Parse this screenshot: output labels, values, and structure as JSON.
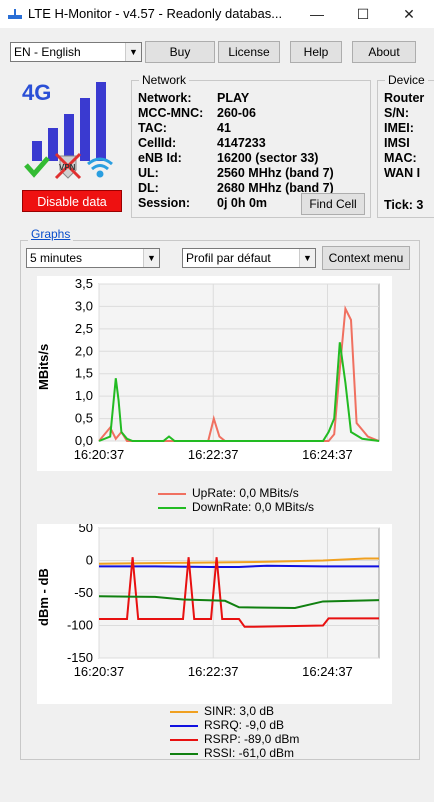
{
  "window": {
    "title": "LTE H-Monitor - v4.57 - Readonly databas...",
    "minimize": "—",
    "maximize": "☐",
    "close": "✕"
  },
  "toolbar": {
    "language": "EN - English",
    "buy": "Buy",
    "license": "License",
    "help": "Help",
    "about": "About"
  },
  "status": {
    "badge": "4G",
    "vpn": "VPN",
    "disable_data": "Disable data",
    "signal_bars": 5
  },
  "network": {
    "title": "Network",
    "rows": [
      {
        "label": "Network:",
        "value": "PLAY"
      },
      {
        "label": "MCC-MNC:",
        "value": "260-06"
      },
      {
        "label": "TAC:",
        "value": "41"
      },
      {
        "label": "CellId:",
        "value": "4147233"
      },
      {
        "label": "eNB Id:",
        "value": "16200 (sector 33)"
      },
      {
        "label": "UL:",
        "value": "2560 MHhz (band 7)"
      },
      {
        "label": "DL:",
        "value": "2680 MHhz (band 7)"
      },
      {
        "label": "Session:",
        "value": "0j 0h 0m"
      }
    ],
    "find_cell": "Find Cell"
  },
  "device": {
    "title": "Device",
    "rows": [
      "Router",
      "S/N:",
      "IMEI:",
      "IMSI",
      "MAC:",
      "WAN I"
    ],
    "tick": "Tick: 3"
  },
  "graphs": {
    "title": "Graphs",
    "interval": "5 minutes",
    "profile": "Profil par défaut",
    "context_menu": "Context menu"
  },
  "chart_data": [
    {
      "type": "line",
      "ylabel": "MBits/s",
      "ylim": [
        0,
        3.5
      ],
      "yticks": [
        "3,5",
        "3,0",
        "2,5",
        "2,0",
        "1,5",
        "1,0",
        "0,5",
        "0,0"
      ],
      "xticks": [
        "16:20:37",
        "16:22:37",
        "16:24:37"
      ],
      "series": [
        {
          "name": "UpRate: 0,0 MBits/s",
          "color": "#f07060",
          "x": [
            0,
            0.04,
            0.06,
            0.08,
            0.1,
            0.12,
            0.14,
            0.39,
            0.41,
            0.43,
            0.45,
            0.82,
            0.84,
            0.86,
            0.88,
            0.9,
            0.92,
            0.94,
            0.96,
            1.0
          ],
          "values": [
            0,
            0.3,
            0.05,
            0.2,
            0,
            0,
            0,
            0,
            0.5,
            0.1,
            0,
            0,
            0.15,
            1.6,
            2.95,
            2.7,
            0.4,
            0.25,
            0.1,
            0
          ]
        },
        {
          "name": "DownRate: 0,0 MBits/s",
          "color": "#22bb22",
          "x": [
            0,
            0.04,
            0.06,
            0.07,
            0.08,
            0.1,
            0.12,
            0.23,
            0.25,
            0.27,
            0.6,
            0.8,
            0.82,
            0.84,
            0.86,
            0.88,
            0.9,
            0.94,
            1.0
          ],
          "values": [
            0,
            0.1,
            1.4,
            0.9,
            0.2,
            0.05,
            0,
            0,
            0.1,
            0,
            0,
            0,
            0.2,
            0.5,
            2.2,
            1.3,
            0.2,
            0.05,
            0
          ]
        }
      ]
    },
    {
      "type": "line",
      "ylabel": "dBm - dB",
      "ylim": [
        -150,
        50
      ],
      "yticks": [
        "50",
        "0",
        "-50",
        "-100",
        "-150"
      ],
      "xticks": [
        "16:20:37",
        "16:22:37",
        "16:24:37"
      ],
      "series": [
        {
          "name": "SINR: 3,0 dB",
          "color": "#f0a020",
          "x": [
            0,
            0.2,
            0.4,
            0.6,
            0.8,
            0.95,
            1.0
          ],
          "values": [
            -5,
            -4,
            -3,
            -2,
            0,
            3,
            3
          ]
        },
        {
          "name": "RSRQ: -9,0 dB",
          "color": "#1010e0",
          "x": [
            0,
            0.2,
            0.4,
            0.5,
            0.6,
            0.8,
            1.0
          ],
          "values": [
            -9,
            -9,
            -10,
            -10,
            -8,
            -9,
            -9
          ]
        },
        {
          "name": "RSRP: -89,0 dBm",
          "color": "#e81010",
          "x": [
            0,
            0.1,
            0.12,
            0.14,
            0.3,
            0.32,
            0.34,
            0.4,
            0.42,
            0.44,
            0.5,
            0.52,
            0.54,
            0.8,
            0.82,
            1.0
          ],
          "values": [
            -90,
            -90,
            5,
            -90,
            -90,
            5,
            -90,
            -90,
            5,
            -90,
            -90,
            -102,
            -102,
            -100,
            -89,
            -89
          ]
        },
        {
          "name": "RSSI: -61,0 dBm",
          "color": "#108010",
          "x": [
            0,
            0.2,
            0.3,
            0.45,
            0.5,
            0.7,
            0.8,
            1.0
          ],
          "values": [
            -55,
            -56,
            -60,
            -62,
            -72,
            -73,
            -63,
            -61
          ]
        }
      ]
    }
  ]
}
